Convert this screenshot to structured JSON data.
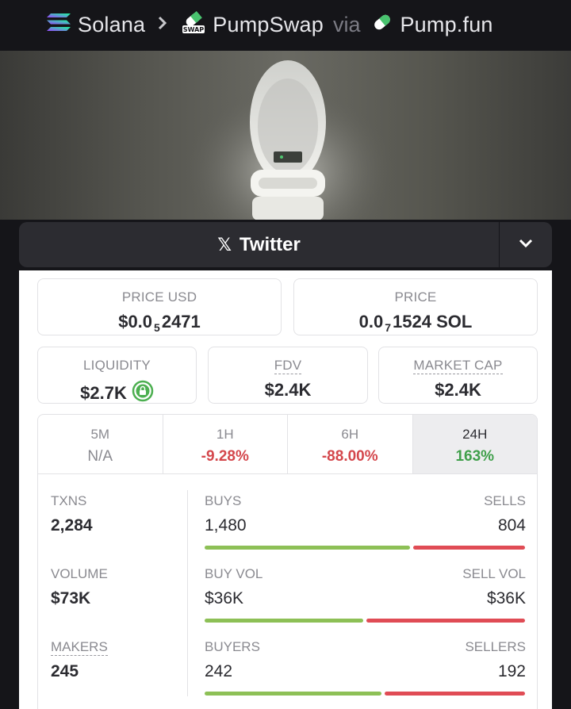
{
  "breadcrumb": {
    "chain": "Solana",
    "dex": "PumpSwap",
    "dex_badge": "SWAP",
    "via": "via",
    "launchpad": "Pump.fun"
  },
  "social": {
    "label": "Twitter",
    "x_glyph": "𝕏"
  },
  "price_usd": {
    "title": "PRICE USD",
    "lead": "$0.0",
    "zeros": "5",
    "digits": "2471"
  },
  "price_native": {
    "title": "PRICE",
    "lead": "0.0",
    "zeros": "7",
    "digits": "1524 SOL"
  },
  "liquidity": {
    "title": "LIQUIDITY",
    "value": "$2.7K"
  },
  "fdv": {
    "title": "FDV",
    "value": "$2.4K"
  },
  "market_cap": {
    "title": "MARKET CAP",
    "value": "$2.4K"
  },
  "timeframes": [
    {
      "label": "5M",
      "value": "N/A"
    },
    {
      "label": "1H",
      "value": "-9.28%"
    },
    {
      "label": "6H",
      "value": "-88.00%"
    },
    {
      "label": "24H",
      "value": "163%"
    }
  ],
  "stats": {
    "txns": {
      "label": "TXNS",
      "value": "2,284",
      "left_label": "BUYS",
      "left_value": "1,480",
      "right_label": "SELLS",
      "right_value": "804",
      "buy_fraction": 0.648
    },
    "volume": {
      "label": "VOLUME",
      "value": "$73K",
      "left_label": "BUY VOL",
      "left_value": "$36K",
      "right_label": "SELL VOL",
      "right_value": "$36K",
      "buy_fraction": 0.5
    },
    "makers": {
      "label": "MAKERS",
      "value": "245",
      "left_label": "BUYERS",
      "left_value": "242",
      "right_label": "SELLERS",
      "right_value": "192",
      "buy_fraction": 0.558
    }
  },
  "colors": {
    "positive": "#3f9f4a",
    "negative": "#d4474c",
    "buy_bar": "#8dc056",
    "sell_bar": "#e04c55",
    "page_bg": "#151519"
  },
  "icons": [
    "solana-logo-icon",
    "chevron-right-icon",
    "pumpswap-logo-icon",
    "pill-logo-icon",
    "x-logo-icon",
    "chevron-down-icon",
    "lock-icon"
  ]
}
